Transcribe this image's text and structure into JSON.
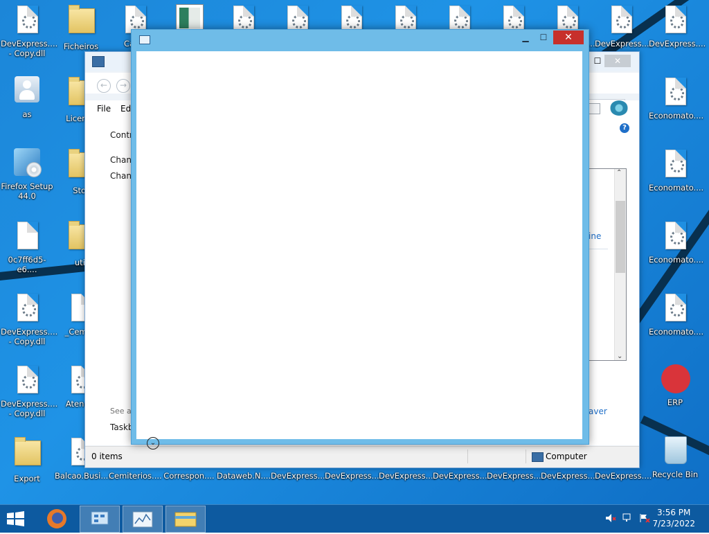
{
  "desktop": {
    "icons": [
      {
        "label": "DevExpress.... - Copy.dll",
        "type": "file"
      },
      {
        "label": "Ficheiros",
        "type": "folder"
      },
      {
        "label": "Canic",
        "type": "file"
      },
      {
        "label": "",
        "type": "thumb"
      },
      {
        "label": "",
        "type": "file"
      },
      {
        "label": "",
        "type": "file"
      },
      {
        "label": "",
        "type": "file"
      },
      {
        "label": "",
        "type": "file"
      },
      {
        "label": "",
        "type": "file"
      },
      {
        "label": "",
        "type": "file"
      },
      {
        "label": "DevExpress....",
        "type": "file"
      },
      {
        "label": "DevExpress....",
        "type": "file"
      },
      {
        "label": "DevExpress....",
        "type": "file"
      },
      {
        "label": "as",
        "type": "user"
      },
      {
        "label": "Licence",
        "type": "folder"
      },
      {
        "label": "Economato....",
        "type": "file"
      },
      {
        "label": "Firefox Setup 44.0",
        "type": "setup"
      },
      {
        "label": "Stor",
        "type": "folder"
      },
      {
        "label": "Economato....",
        "type": "file"
      },
      {
        "label": "0c7ff6d5-e6....",
        "type": "blank"
      },
      {
        "label": "util",
        "type": "folder"
      },
      {
        "label": "Economato....",
        "type": "file"
      },
      {
        "label": "DevExpress.... - Copy.dll",
        "type": "file"
      },
      {
        "label": "_Cemite",
        "type": "blank"
      },
      {
        "label": "Economato....",
        "type": "file"
      },
      {
        "label": "DevExpress.... - Copy.dll",
        "type": "file"
      },
      {
        "label": "Atendin",
        "type": "file"
      },
      {
        "label": "ERP",
        "type": "erp"
      },
      {
        "label": "Export",
        "type": "folder"
      },
      {
        "label": "Balcao.Busi....",
        "type": "file"
      },
      {
        "label": "Cemiterios....",
        "type": "file"
      },
      {
        "label": "Correspon....",
        "type": "file"
      },
      {
        "label": "Dataweb.N....",
        "type": "file"
      },
      {
        "label": "DevExpress....",
        "type": "file"
      },
      {
        "label": "DevExpress....",
        "type": "file"
      },
      {
        "label": "DevExpress....",
        "type": "file"
      },
      {
        "label": "DevExpress....",
        "type": "file"
      },
      {
        "label": "DevExpress....",
        "type": "file"
      },
      {
        "label": "DevExpress....",
        "type": "file"
      },
      {
        "label": "DevExpress....",
        "type": "file"
      },
      {
        "label": "Recycle Bin",
        "type": "bin"
      }
    ]
  },
  "background_window": {
    "menu": [
      "File",
      "Edi"
    ],
    "side_links": [
      "Contr",
      "Chang",
      "Chang"
    ],
    "see_also": "See al",
    "taskbar_link": "Taskb",
    "list_link": "ine",
    "list_link2": "aver",
    "status_items": "0 items",
    "status_location": "Computer"
  },
  "taskbar": {
    "time": "3:56 PM",
    "date": "7/23/2022"
  },
  "colors": {
    "desktop": "#1f8fe2",
    "taskbar": "#0d5aa0",
    "close": "#c7302b",
    "window_frame": "#6fbce8"
  }
}
